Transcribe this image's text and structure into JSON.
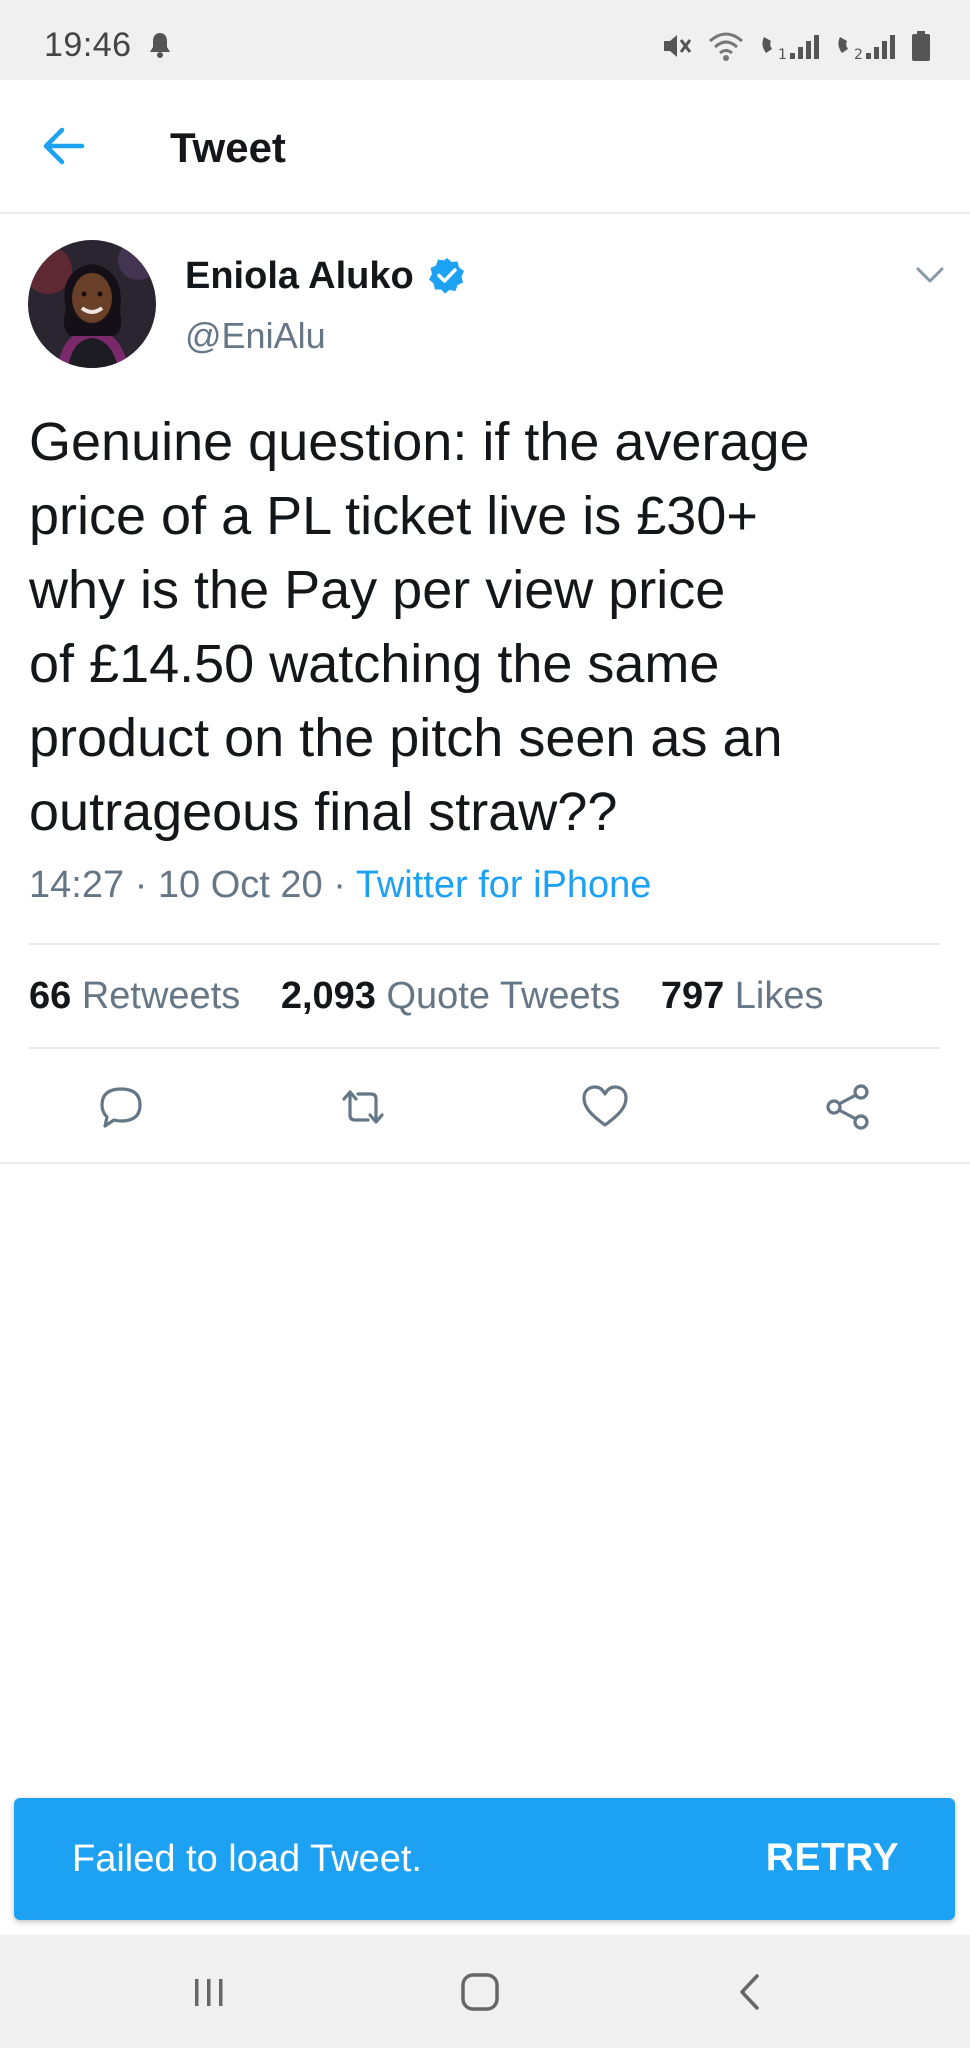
{
  "status_bar": {
    "time": "19:46"
  },
  "header": {
    "title": "Tweet"
  },
  "tweet": {
    "author_name": "Eniola Aluko",
    "author_handle": "@EniAlu",
    "text_lines": [
      "Genuine question: if the average",
      "price of a PL ticket live is £30+",
      "why is the Pay per view price",
      "of £14.50 watching the same",
      "product on the pitch seen as an",
      "outrageous final straw??"
    ],
    "time": "14:27",
    "separator": " · ",
    "date": "10 Oct 20",
    "source": "Twitter for iPhone"
  },
  "stats": {
    "retweets_count": "66",
    "retweets_label": "Retweets",
    "quote_tweets_count": "2,093",
    "quote_tweets_label": "Quote Tweets",
    "likes_count": "797",
    "likes_label": "Likes"
  },
  "snackbar": {
    "message": "Failed to load Tweet.",
    "action_label": "RETRY"
  },
  "colors": {
    "accent": "#1da1f2",
    "text_primary": "#14171a",
    "text_secondary": "#657786",
    "divider": "#e6ecf0"
  }
}
